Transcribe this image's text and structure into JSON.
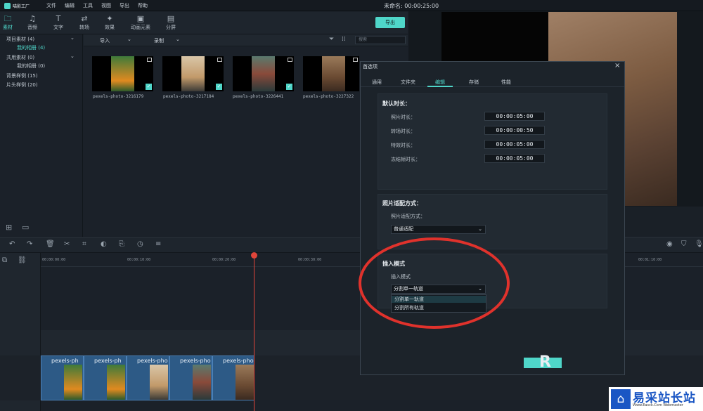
{
  "app": {
    "logo_text": "喵影工厂",
    "window_title": "未命名: 00:00:25:00"
  },
  "menu": [
    "文件",
    "编辑",
    "工具",
    "视图",
    "导出",
    "帮助"
  ],
  "toolbar": {
    "tools": [
      {
        "label": "素材",
        "icon": "folder-icon"
      },
      {
        "label": "音频",
        "icon": "music-icon"
      },
      {
        "label": "文字",
        "icon": "text-icon"
      },
      {
        "label": "转场",
        "icon": "transition-icon"
      },
      {
        "label": "效果",
        "icon": "effects-icon"
      },
      {
        "label": "动画元素",
        "icon": "elements-icon"
      },
      {
        "label": "分屏",
        "icon": "splitscreen-icon"
      }
    ],
    "export_label": "导出"
  },
  "sidebar": {
    "items": [
      {
        "label": "项目素材 (4)"
      },
      {
        "label": "我的相册 (4)"
      },
      {
        "label": "共用素材 (0)"
      },
      {
        "label": "我的相册 (0)"
      },
      {
        "label": "背景样例 (15)"
      },
      {
        "label": "片头样例 (20)"
      }
    ]
  },
  "media": {
    "import_label": "导入",
    "record_label": "录制",
    "search_placeholder": "搜索",
    "items": [
      {
        "name": "pexels-photo-3216179"
      },
      {
        "name": "pexels-photo-3217184"
      },
      {
        "name": "pexels-photo-3226441"
      },
      {
        "name": "pexels-photo-3227322"
      }
    ]
  },
  "timeline": {
    "ruler": [
      "00:00:00:00",
      "00:00:10:00",
      "00:00:20:00",
      "00:00:30:00",
      "00:01:10:00"
    ],
    "clips": [
      "pexels-ph",
      "pexels-ph",
      "pexels-pho",
      "pexels-pho",
      "pexels-pho"
    ]
  },
  "dialog": {
    "title": "首选项",
    "tabs": [
      "通用",
      "文件夹",
      "编辑",
      "存储",
      "性能"
    ],
    "default_duration": {
      "title": "默认时长：",
      "rows": [
        {
          "label": "照片时长：",
          "value": "00:00:05:00"
        },
        {
          "label": "转场时长：",
          "value": "00:00:00:50"
        },
        {
          "label": "特效时长：",
          "value": "00:00:05:00"
        },
        {
          "label": "冻结帧时长：",
          "value": "00:00:05:00"
        }
      ]
    },
    "photo_fit": {
      "title": "照片适配方式：",
      "label": "照片适配方式：",
      "value": "普通适配"
    },
    "insert_mode": {
      "title": "插入模式",
      "label": "插入模式",
      "value": "分割单一轨道",
      "options": [
        "分割单一轨道",
        "分割所有轨道"
      ]
    },
    "ok_label": "R"
  },
  "watermark": {
    "text": "易采站长站",
    "sub": "Www.Easck.Com Webmaster"
  }
}
